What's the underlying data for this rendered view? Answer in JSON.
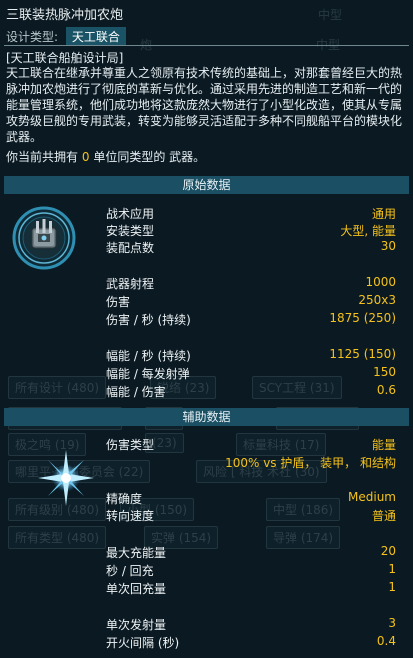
{
  "background_ghost": {
    "medium_1": "中型",
    "medium_2": "中型",
    "medium_3": "中型",
    "fragment_cannon": "炮",
    "row1": [
      "所有设计 (480)",
      "锐络 (23)",
      "SCY工程 (31)"
    ],
    "row2": [
      "星空共享有线 (26)",
      "制品",
      "野道科技 (6)"
    ],
    "row3": [
      "极之鸣 (19)",
      "(23)",
      "标量科技 (17)"
    ],
    "row4": [
      "哪里平·运输委员会 (22)",
      "风险 [ 科技 术社 (30)"
    ],
    "row5": [
      "所有级别 (480)",
      "小型 (150)",
      "中型 (186)"
    ],
    "row6": [
      "所有类型 (480)",
      "实弹 (154)",
      "导弹 (174)"
    ]
  },
  "header": {
    "title": "三联装热脉冲加农炮",
    "design_type_label": "设计类型:",
    "design_type_value": "天工联合"
  },
  "description": {
    "title": "[天工联合船舶设计局]",
    "body": "天工联合在继承并尊重人之领原有技术传统的基础上，对那套曾经巨大的热脉冲加农炮进行了彻底的革新与优化。通过采用先进的制造工艺和新一代的能量管理系统，他们成功地将这款庞然大物进行了小型化改造，使其从专属攻势级巨舰的专用武装，转变为能够灵活适配于多种不同舰船平台的模块化武器。"
  },
  "ownership": {
    "prefix": "你当前共拥有",
    "count": "0",
    "suffix": "单位同类型的 武器。"
  },
  "sections": {
    "primary": "原始数据",
    "auxiliary": "辅助数据"
  },
  "primary_stats": [
    {
      "label": "战术应用",
      "value": "通用"
    },
    {
      "label": "安装类型",
      "value": "大型, 能量"
    },
    {
      "label": "装配点数",
      "value": "30"
    },
    {
      "label": "武器射程",
      "value": "1000"
    },
    {
      "label": "伤害",
      "value": "250x3"
    },
    {
      "label": "伤害 / 秒 (持续)",
      "value": "1875 (250)"
    },
    {
      "label": "幅能 / 秒 (持续)",
      "value": "1125 (150)"
    },
    {
      "label": "幅能 / 每发射弹",
      "value": "150"
    },
    {
      "label": "幅能 / 伤害",
      "value": "0.6"
    }
  ],
  "aux_stats": {
    "damage_type_label": "伤害类型",
    "damage_type_value": "能量",
    "damage_note": "100% vs 护盾， 装甲， 和结构",
    "rows": [
      {
        "label": "精确度",
        "value": "Medium"
      },
      {
        "label": "转向速度",
        "value": "普通"
      },
      {
        "label": "最大充能量",
        "value": "20"
      },
      {
        "label": "秒 / 回充",
        "value": "1"
      },
      {
        "label": "单次回充量",
        "value": "1"
      },
      {
        "label": "单次发射量",
        "value": "3"
      },
      {
        "label": "开火间隔 (秒)",
        "value": "0.4"
      }
    ]
  },
  "icons": {
    "weapon": "triple-cannon-icon",
    "damage_type": "energy-burst-icon"
  },
  "colors": {
    "accent": "#f5c21b",
    "section_bar": "#1b4f63",
    "pill": "#1b5366",
    "background": "#0b1a22"
  }
}
